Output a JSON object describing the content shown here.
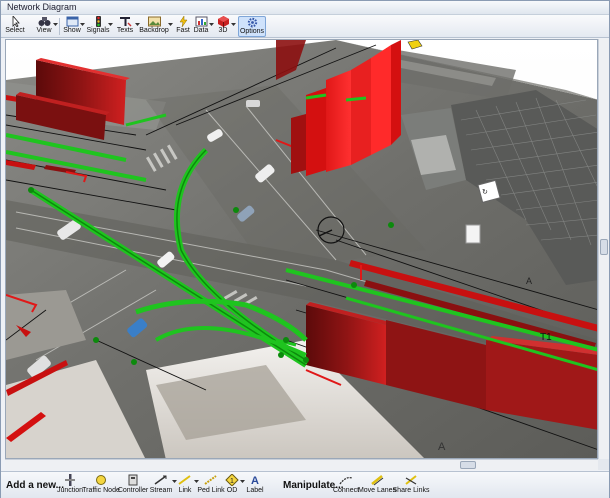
{
  "window": {
    "title": "Network Diagram"
  },
  "toolbar": {
    "items": [
      {
        "label": "Select",
        "icon": "cursor-arrow-icon"
      },
      {
        "label": "View",
        "icon": "binoculars-icon"
      },
      {
        "label": "Show",
        "icon": "show-window-icon"
      },
      {
        "label": "Signals",
        "icon": "traffic-light-icon"
      },
      {
        "label": "Texts",
        "icon": "text-tag-icon"
      },
      {
        "label": "Backdrop",
        "icon": "backdrop-image-icon"
      },
      {
        "label": "Fast",
        "icon": "lightning-icon"
      },
      {
        "label": "Data",
        "icon": "data-chart-icon"
      },
      {
        "label": "3D",
        "icon": "cube-3d-icon"
      },
      {
        "label": "Options",
        "icon": "options-gear-icon"
      }
    ],
    "selected": "Options"
  },
  "scene": {
    "labels": [
      "T1",
      "A",
      "A"
    ],
    "colors": {
      "red_bar": "#d41010",
      "dark_bar": "#7a1010",
      "green_link": "#1fc41f",
      "green_dark": "#0c8a0c"
    }
  },
  "bottombar": {
    "add_label": "Add a new...",
    "add_items": [
      {
        "label": "Junction",
        "icon": "junction-icon"
      },
      {
        "label": "Traffic Node",
        "icon": "traffic-node-icon"
      },
      {
        "label": "Controller",
        "icon": "controller-icon"
      },
      {
        "label": "Stream",
        "icon": "stream-icon"
      },
      {
        "label": "Link",
        "icon": "link-icon"
      },
      {
        "label": "Ped Link",
        "icon": "ped-link-icon"
      },
      {
        "label": "OD",
        "icon": "od-icon"
      },
      {
        "label": "Label",
        "icon": "label-icon"
      }
    ],
    "manipulate_label": "Manipulate...",
    "manipulate_items": [
      {
        "label": "Connect",
        "icon": "connect-icon"
      },
      {
        "label": "Move Lanes",
        "icon": "move-lanes-icon"
      },
      {
        "label": "Share Links",
        "icon": "share-links-icon"
      }
    ]
  }
}
